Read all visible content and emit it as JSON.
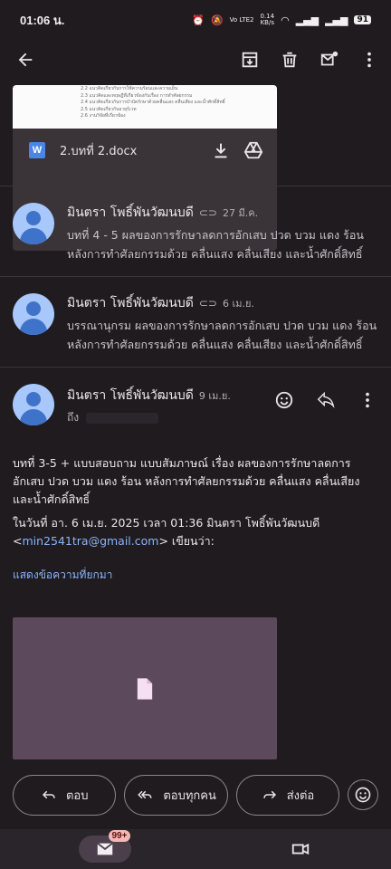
{
  "status": {
    "time": "01:06 น.",
    "net_speed": "0.14",
    "net_unit": "KB/s",
    "net_type": "Vo LTE2",
    "battery": "91"
  },
  "attachment": {
    "file_name": "2.บทที่ 2.docx",
    "file_icon_letter": "W",
    "preview_lines": [
      "2.2 แนวคิดเกี่ยวกับการใช้ความร้อนและความเย็น ",
      "2.3 แนวคิดและทฤษฎีที่เกี่ยวข้องกับเรื่อง การทำศัลยกรรม",
      "2.4 แนวคิดเกี่ยวกับการบำบัดรักษาด้วยคลื่นแสง คลื่นเสียง และน้ำศักดิ์สิทธิ์",
      "2.5 แนวคิดเกี่ยวกับอายุร์เวท",
      "2.6 งานวิจัยที่เกี่ยวข้อง"
    ]
  },
  "messages": [
    {
      "sender": "มินตรา โพธิ์พันวัฒนบดี",
      "date": "27 มี.ค.",
      "has_attachment": true,
      "snippet": "บทที่ 4 - 5 ผลของการรักษาลดการอักเสบ ปวด บวม แดง ร้อน หลังการทำศัลยกรรมด้วย คลื่นแสง คลื่นเสียง และน้ำศักดิ์สิทธิ์"
    },
    {
      "sender": "มินตรา โพธิ์พันวัฒนบดี",
      "date": "6 เม.ย.",
      "has_attachment": true,
      "snippet": "บรรณานุกรม ผลของการรักษาลดการอักเสบ ปวด บวม แดง ร้อน หลังการทำศัลยกรรมด้วย คลื่นแสง คลื่นเสียง และน้ำศักดิ์สิทธิ์"
    }
  ],
  "expanded": {
    "sender": "มินตรา โพธิ์พันวัฒนบดี",
    "date": "9 เม.ย.",
    "to_label": "ถึง",
    "body": "บทที่ 3-5 + แบบสอบถาม แบบสัมภาษณ์ เรื่อง ผลของการรักษาลดการอักเสบ ปวด บวม แดง ร้อน หลังการทำศัลยกรรมด้วย คลื่นแสง คลื่นเสียง และน้ำศักดิ์สิทธิ์",
    "quote_header_prefix": "ในวันที่ อา. 6 เม.ย. 2025 เวลา 01:36 มินตรา โพธิ์พันวัฒนบดี",
    "quote_email": "min2541tra@gmail.com",
    "quote_suffix": "> เขียนว่า:",
    "show_quoted": "แสดงข้อความที่ยกมา"
  },
  "actions": {
    "reply": "ตอบ",
    "reply_all": "ตอบทุกคน",
    "forward": "ส่งต่อ"
  },
  "nav": {
    "mail_badge": "99+"
  },
  "colors": {
    "background": "#1f1b1f",
    "avatar": "#a8c7fa",
    "link": "#8ab4f8",
    "badge": "#f2b8b5"
  },
  "icons": [
    "back-arrow-icon",
    "archive-icon",
    "delete-icon",
    "mark-unread-icon",
    "more-vert-icon",
    "download-icon",
    "drive-icon",
    "paperclip-icon",
    "emoji-icon",
    "reply-icon",
    "reply-all-icon",
    "forward-icon",
    "file-icon",
    "mail-icon",
    "video-icon"
  ]
}
